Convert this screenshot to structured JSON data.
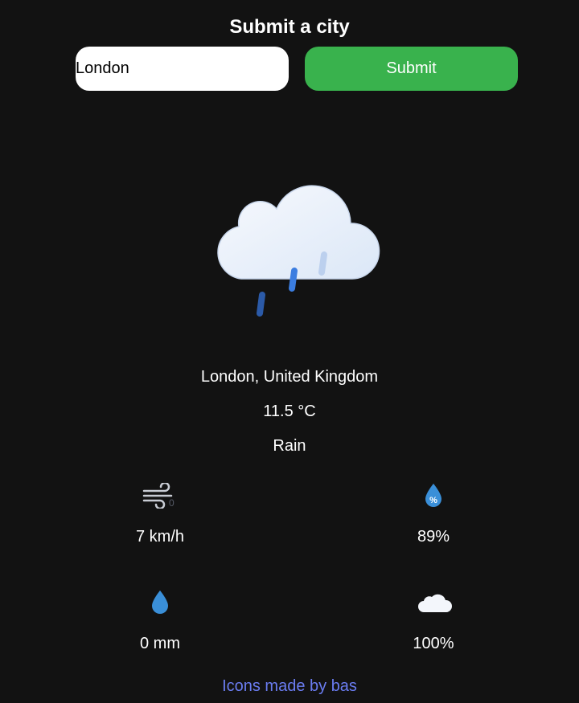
{
  "form": {
    "title": "Submit a city",
    "city_value": "London",
    "submit_label": "Submit"
  },
  "weather": {
    "main_icon": "cloud-rain-icon",
    "location": "London, United Kingdom",
    "temperature": "11.5 °C",
    "condition": "Rain"
  },
  "stats": {
    "wind": {
      "icon": "wind-icon",
      "value": "7 km/h"
    },
    "humidity": {
      "icon": "humidity-icon",
      "value": "89%"
    },
    "precipitation": {
      "icon": "raindrop-icon",
      "value": "0 mm"
    },
    "cloud_cover": {
      "icon": "cloud-icon",
      "value": "100%"
    }
  },
  "footer": {
    "credit": "Icons made by bas"
  },
  "colors": {
    "background": "#121212",
    "submit": "#39b24d",
    "link": "#6a7cf0",
    "drop": "#3a8fd8"
  }
}
